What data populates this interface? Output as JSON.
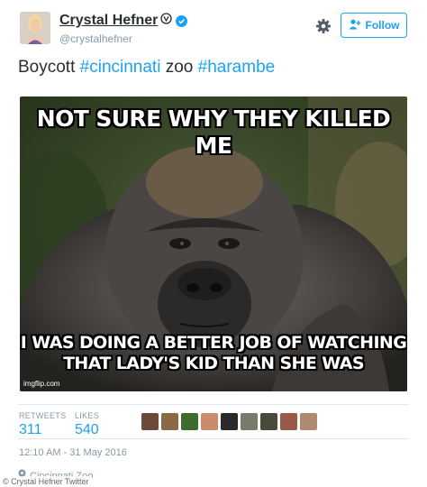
{
  "user": {
    "display_name": "Crystal Hefner",
    "screen_name": "@crystalhefner",
    "verified": true
  },
  "follow_button": {
    "label": "Follow"
  },
  "tweet": {
    "text_prefix": "Boycott ",
    "hashtag1": "#cincinnati",
    "text_middle": " zoo ",
    "hashtag2": "#harambe"
  },
  "media": {
    "top_caption": "NOT SURE WHY THEY KILLED ME",
    "bottom_caption_line1": "I WAS DOING A BETTER JOB OF WATCHING",
    "bottom_caption_line2": "THAT LADY'S KID THAN SHE WAS",
    "watermark": "imgflip.com"
  },
  "stats": {
    "retweets_label": "RETWEETS",
    "retweets_value": "311",
    "likes_label": "LIKES",
    "likes_value": "540"
  },
  "likers": [
    {
      "name": "liker-avatar-1",
      "color": "#6b4a3a"
    },
    {
      "name": "liker-avatar-2",
      "color": "#8a6a45"
    },
    {
      "name": "liker-avatar-3",
      "color": "#3e6b2e"
    },
    {
      "name": "liker-avatar-4",
      "color": "#c98b6b"
    },
    {
      "name": "liker-avatar-5",
      "color": "#2a2a2a"
    },
    {
      "name": "liker-avatar-6",
      "color": "#7a7a6a"
    },
    {
      "name": "liker-avatar-7",
      "color": "#4a4a3a"
    },
    {
      "name": "liker-avatar-8",
      "color": "#9a5a4a"
    },
    {
      "name": "liker-avatar-9",
      "color": "#b08a70"
    }
  ],
  "timestamp": "12:10 AM - 31 May 2016",
  "location": "Cincinnati Zoo",
  "credit": "© Crystal Hefner Twitter",
  "colors": {
    "accent": "#1da1f2",
    "text": "#292f33",
    "muted": "#8899a6",
    "divider": "#e1e8ed"
  }
}
